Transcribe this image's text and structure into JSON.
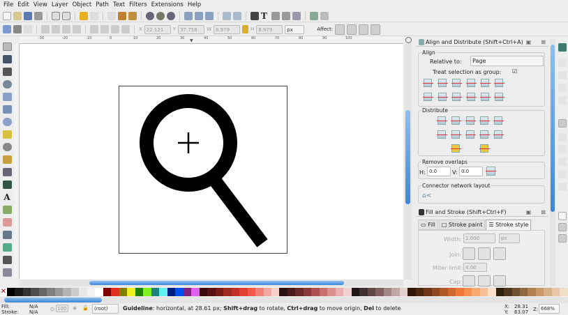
{
  "menu": [
    "File",
    "Edit",
    "View",
    "Layer",
    "Object",
    "Path",
    "Text",
    "Filters",
    "Extensions",
    "Help"
  ],
  "toolcontrols": {
    "x_label": "X",
    "x_value": "22.121",
    "y_label": "Y",
    "y_value": "37.758",
    "w_label": "W",
    "w_value": "8.979",
    "h_label": "H",
    "h_value": "8.979",
    "unit": "px",
    "affect_label": "Affect:"
  },
  "ruler_labels": [
    "-30",
    "-20",
    "-10",
    "0",
    "10",
    "20",
    "30",
    "40",
    "50",
    "60",
    "70",
    "80",
    "90",
    "100"
  ],
  "tools": [
    "selector",
    "node",
    "tweak",
    "zoom",
    "rectangle",
    "3d-box",
    "ellipse",
    "star",
    "spiral",
    "pencil",
    "pen",
    "calligraphy",
    "text",
    "spray",
    "eraser",
    "bucket",
    "gradient",
    "dropper",
    "connector"
  ],
  "align_panel": {
    "title": "Align and Distribute (Shift+Ctrl+A)",
    "align_label": "Align",
    "relative_to_label": "Relative to:",
    "relative_to_value": "Page",
    "treat_group_label": "Treat selection as group:",
    "treat_group_checked": true,
    "distribute_label": "Distribute",
    "remove_overlaps_label": "Remove overlaps",
    "h_label": "H:",
    "h_value": "0.0",
    "v_label": "V:",
    "v_value": "0.0",
    "connector_label": "Connector network layout"
  },
  "fill_panel": {
    "title": "Fill and Stroke (Shift+Ctrl+F)",
    "tabs": [
      "Fill",
      "Stroke paint",
      "Stroke style"
    ],
    "active_tab": "Stroke style",
    "width_label": "Width:",
    "width_value": "1.000",
    "width_unit": "px",
    "join_label": "Join:",
    "miter_label": "Miter limit:",
    "miter_value": "4.00",
    "cap_label": "Cap:"
  },
  "palette": [
    "#000000",
    "#1a1a1a",
    "#333333",
    "#4d4d4d",
    "#666666",
    "#808080",
    "#999999",
    "#b3b3b3",
    "#cccccc",
    "#e6e6e6",
    "#f2f2f2",
    "#ffffff",
    "#800000",
    "#e03020",
    "#808000",
    "#f0f020",
    "#208000",
    "#80f020",
    "#208080",
    "#60f0f0",
    "#002080",
    "#0050f0",
    "#802080",
    "#e060f0",
    "#3a0808",
    "#5a1010",
    "#7a1a14",
    "#a02a20",
    "#c03028",
    "#e04030",
    "#f05848",
    "#f08078",
    "#f0a8a0",
    "#f8d0c8",
    "#2a1010",
    "#4a1a1a",
    "#6a2a2a",
    "#8a3a3a",
    "#b05050",
    "#c87070",
    "#d89090",
    "#e8b0b0",
    "#f0d0d0",
    "#201818",
    "#403030",
    "#604848",
    "#806060",
    "#a08888",
    "#c0a8a8",
    "#e0d0d0",
    "#301808",
    "#502810",
    "#703818",
    "#904820",
    "#b05828",
    "#d06830",
    "#f07838",
    "#f89050",
    "#f8a870",
    "#f8c098",
    "#fce0c8",
    "#302010",
    "#503820",
    "#705030",
    "#906840",
    "#b08050",
    "#c89868",
    "#d8b088",
    "#e8c8a8",
    "#f0e0c8"
  ],
  "status": {
    "fill_label": "Fill:",
    "fill_value": "N/A",
    "stroke_label": "Stroke:",
    "stroke_value": "N/A",
    "opacity_label": "O:",
    "opacity_value": "100",
    "layer": "(root)",
    "message_bold1": "Guideline",
    "message_1": ": horizontal, at 28.61 px; ",
    "message_bold2": "Shift+drag",
    "message_2": " to rotate, ",
    "message_bold3": "Ctrl+drag",
    "message_3": " to move origin, ",
    "message_bold4": "Del",
    "message_4": " to delete",
    "x_label": "X:",
    "x_value": "28.31",
    "y_label": "Y:",
    "y_value": "63.07",
    "zoom_label": "Z:",
    "zoom_value": "668%"
  }
}
